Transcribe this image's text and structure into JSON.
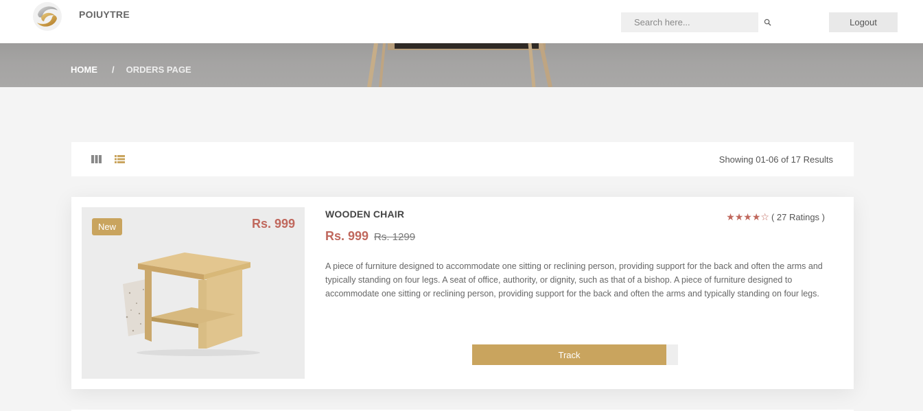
{
  "header": {
    "brand": "POIUYTRE",
    "search_placeholder": "Search here...",
    "logout_label": "Logout"
  },
  "breadcrumb": {
    "home": "HOME",
    "separator": "/",
    "current": "ORDERS PAGE"
  },
  "toolbar": {
    "results_text": "Showing 01-06 of 17 Results",
    "views": [
      "grid-icon",
      "list-icon"
    ]
  },
  "product": {
    "badge": "New",
    "image_price": "Rs. 999",
    "title": "WOODEN CHAIR",
    "price": "Rs. 999",
    "old_price": "Rs. 1299",
    "stars": "★★★★☆",
    "rating_value": 3.5,
    "rating_text": "( 27 Ratings )",
    "description": "A piece of furniture designed to accommodate one sitting or reclining person, providing support for the back and often the arms and typically standing on four legs. A seat of office, authority, or dignity, such as that of a bishop. A piece of furniture designed to accommodate one sitting or reclining person, providing support for the back and often the arms and typically standing on four legs.",
    "track_label": "Track"
  },
  "colors": {
    "accent": "#c9a45e",
    "price": "#c0685d",
    "background": "#f4f4f4"
  }
}
